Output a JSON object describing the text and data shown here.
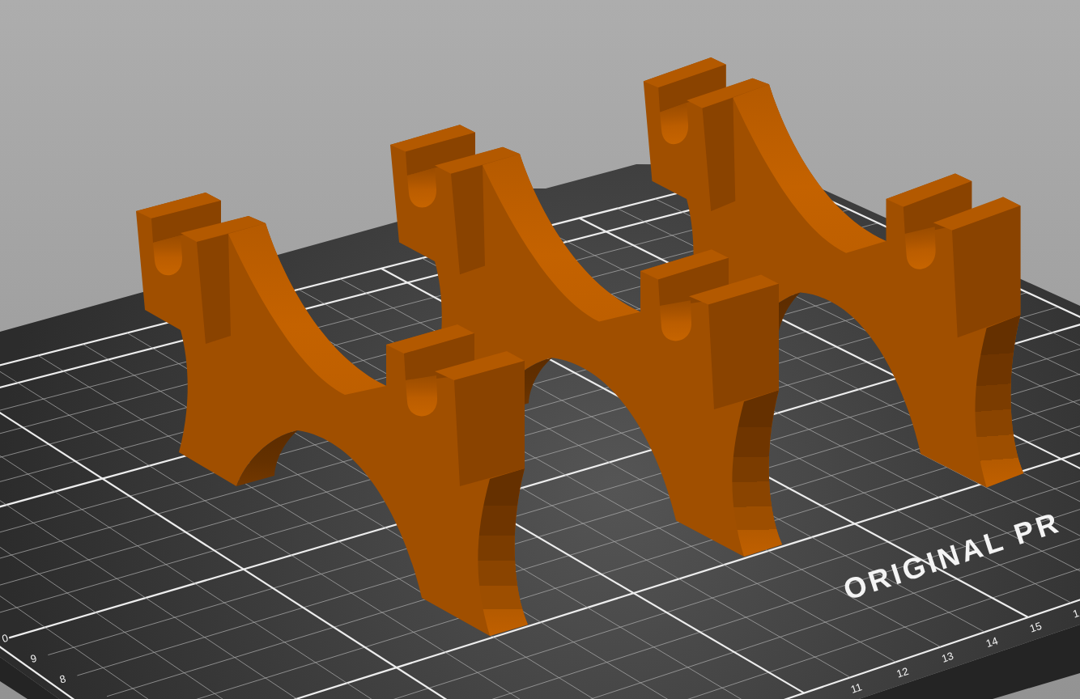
{
  "viewport": {
    "bed": {
      "logo": "ORIGINAL PR",
      "y_axis_labels": [
        "0",
        "9",
        "8"
      ],
      "x_axis_labels": [
        "11",
        "12",
        "13",
        "14",
        "15",
        "1"
      ]
    }
  }
}
